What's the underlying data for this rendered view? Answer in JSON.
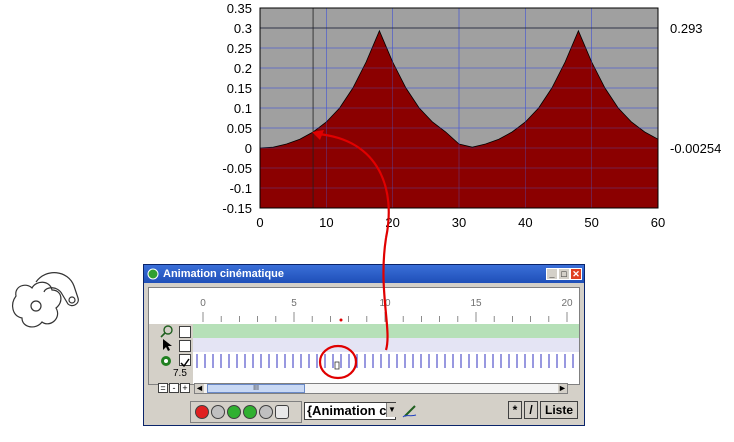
{
  "chart_data": {
    "type": "area",
    "x": [
      0,
      2,
      4,
      6,
      8,
      10,
      12,
      14,
      16,
      18,
      20,
      22,
      24,
      26,
      28,
      30,
      32,
      34,
      36,
      38,
      40,
      42,
      44,
      46,
      48,
      50,
      52,
      54,
      56,
      58,
      60
    ],
    "values": [
      0,
      0.002,
      0.01,
      0.022,
      0.04,
      0.065,
      0.1,
      0.15,
      0.215,
      0.293,
      0.215,
      0.15,
      0.1,
      0.065,
      0.04,
      0.01,
      0.002,
      0.01,
      0.022,
      0.04,
      0.065,
      0.1,
      0.15,
      0.215,
      0.293,
      0.215,
      0.15,
      0.1,
      0.065,
      0.04,
      0.022
    ],
    "xlim": [
      0,
      60
    ],
    "ylim": [
      -0.15,
      0.35
    ],
    "x_ticks": [
      "0",
      "10",
      "20",
      "30",
      "40",
      "50",
      "60"
    ],
    "y_ticks": [
      "0.35",
      "0.3",
      "0.25",
      "0.2",
      "0.15",
      "0.1",
      "0.05",
      "0",
      "-0.05",
      "-0.1",
      "-0.15"
    ],
    "right_labels": {
      "max": "0.293",
      "min": "-0.00254"
    },
    "fill_color": "#8b0000",
    "background_color": "#a0a0a0",
    "grid": true
  },
  "window": {
    "title": "Animation cinématique",
    "minimize": "_",
    "maximize": "□",
    "close": "✕"
  },
  "timeline": {
    "ticks": [
      "0",
      "5",
      "10",
      "15",
      "20"
    ],
    "speed": "7.5",
    "scroll_marker": "III"
  },
  "scroll_buttons": {
    "equal": "=",
    "minus": "-",
    "plus": "+",
    "left": "◄",
    "right": "►"
  },
  "bottom": {
    "animation_name": "{Animation c",
    "star_btn": "*",
    "slash_btn": "/",
    "list_btn": "Liste"
  },
  "colors": {
    "accent": "#1f4fb8",
    "arrow": "#e00000",
    "timeline_ticks": "#3030c0"
  }
}
